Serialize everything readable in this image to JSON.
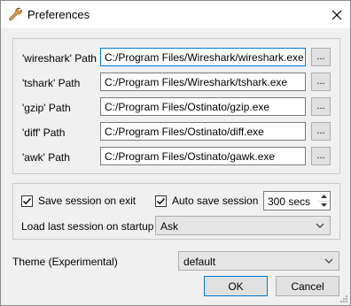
{
  "window": {
    "title": "Preferences",
    "app_icon": "wrench-icon",
    "close_icon": "close-icon"
  },
  "paths": [
    {
      "label": "'wireshark' Path",
      "value": "C:/Program Files/Wireshark/wireshark.exe",
      "browse": "..."
    },
    {
      "label": "'tshark' Path",
      "value": "C:/Program Files/Wireshark/tshark.exe",
      "browse": "..."
    },
    {
      "label": "'gzip' Path",
      "value": "C:/Program Files/Ostinato/gzip.exe",
      "browse": "..."
    },
    {
      "label": "'diff' Path",
      "value": "C:/Program Files/Ostinato/diff.exe",
      "browse": "..."
    },
    {
      "label": "'awk' Path",
      "value": "C:/Program Files/Ostinato/gawk.exe",
      "browse": "..."
    }
  ],
  "session": {
    "save_on_exit_label": "Save session on exit",
    "save_on_exit_checked": true,
    "auto_save_label": "Auto save session",
    "auto_save_checked": true,
    "auto_save_interval": "300 secs",
    "load_last_label": "Load last session on startup",
    "load_last_value": "Ask"
  },
  "theme": {
    "label": "Theme (Experimental)",
    "value": "default"
  },
  "buttons": {
    "ok": "OK",
    "cancel": "Cancel"
  },
  "colors": {
    "focus_accent": "#0078d7",
    "window_bg": "#f0f0f0"
  }
}
